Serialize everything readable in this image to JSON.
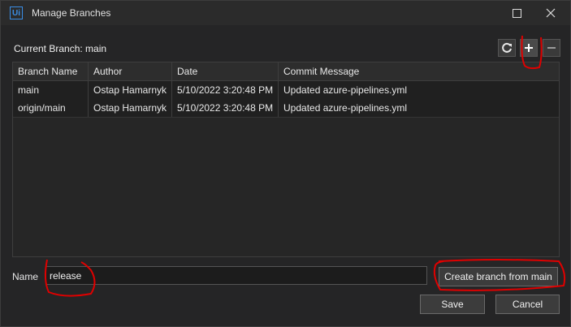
{
  "window": {
    "title": "Manage Branches",
    "app_icon_text": "Ui"
  },
  "current_branch_label": "Current Branch: main",
  "toolbar": {
    "refresh_icon": "refresh-icon",
    "add_icon": "plus-icon",
    "remove_icon": "minus-icon"
  },
  "table": {
    "columns": [
      "Branch Name",
      "Author",
      "Date",
      "Commit Message"
    ],
    "rows": [
      [
        "main",
        "Ostap Hamarnyk",
        "5/10/2022 3:20:48 PM",
        "Updated azure-pipelines.yml"
      ],
      [
        "origin/main",
        "Ostap Hamarnyk",
        "5/10/2022 3:20:48 PM",
        "Updated azure-pipelines.yml"
      ]
    ]
  },
  "name_field": {
    "label": "Name",
    "value": "release"
  },
  "buttons": {
    "create": "Create branch from main",
    "save": "Save",
    "cancel": "Cancel"
  },
  "colors": {
    "background": "#252526",
    "annotation_red": "#e00000",
    "accent": "#3a8ee6"
  }
}
